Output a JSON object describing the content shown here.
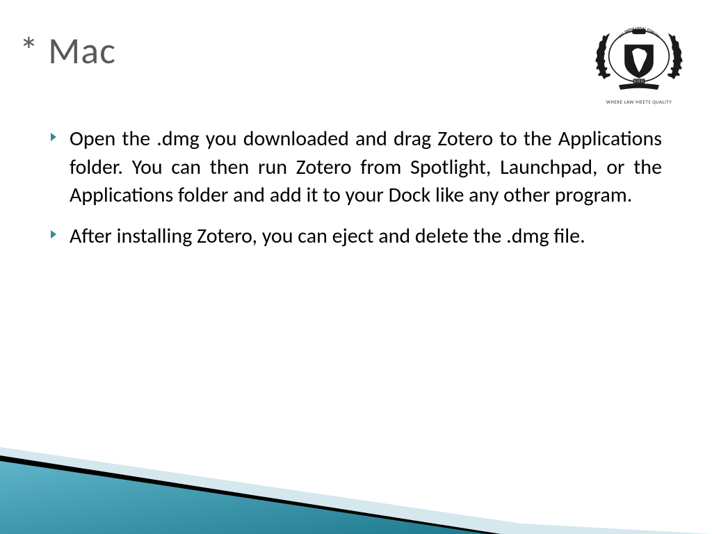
{
  "title": "* Mac",
  "logo": {
    "org_name_top": "ALL INDIA LEGAL FORUM",
    "badge": "AILF",
    "tagline": "WHERE LAW MEETS QUALITY"
  },
  "bullets": [
    "Open the .dmg you downloaded and drag Zotero to the Applications folder. You can then run Zotero from Spotlight, Launchpad, or the Applications folder and add it to your Dock like any other program.",
    "After installing Zotero, you can eject and delete the .dmg file."
  ],
  "colors": {
    "title": "#595959",
    "bullet_accent": "#1f8ba3",
    "wedge_dark": "#2f8ba0",
    "wedge_light": "#d4e8ee",
    "wedge_black": "#000000"
  }
}
